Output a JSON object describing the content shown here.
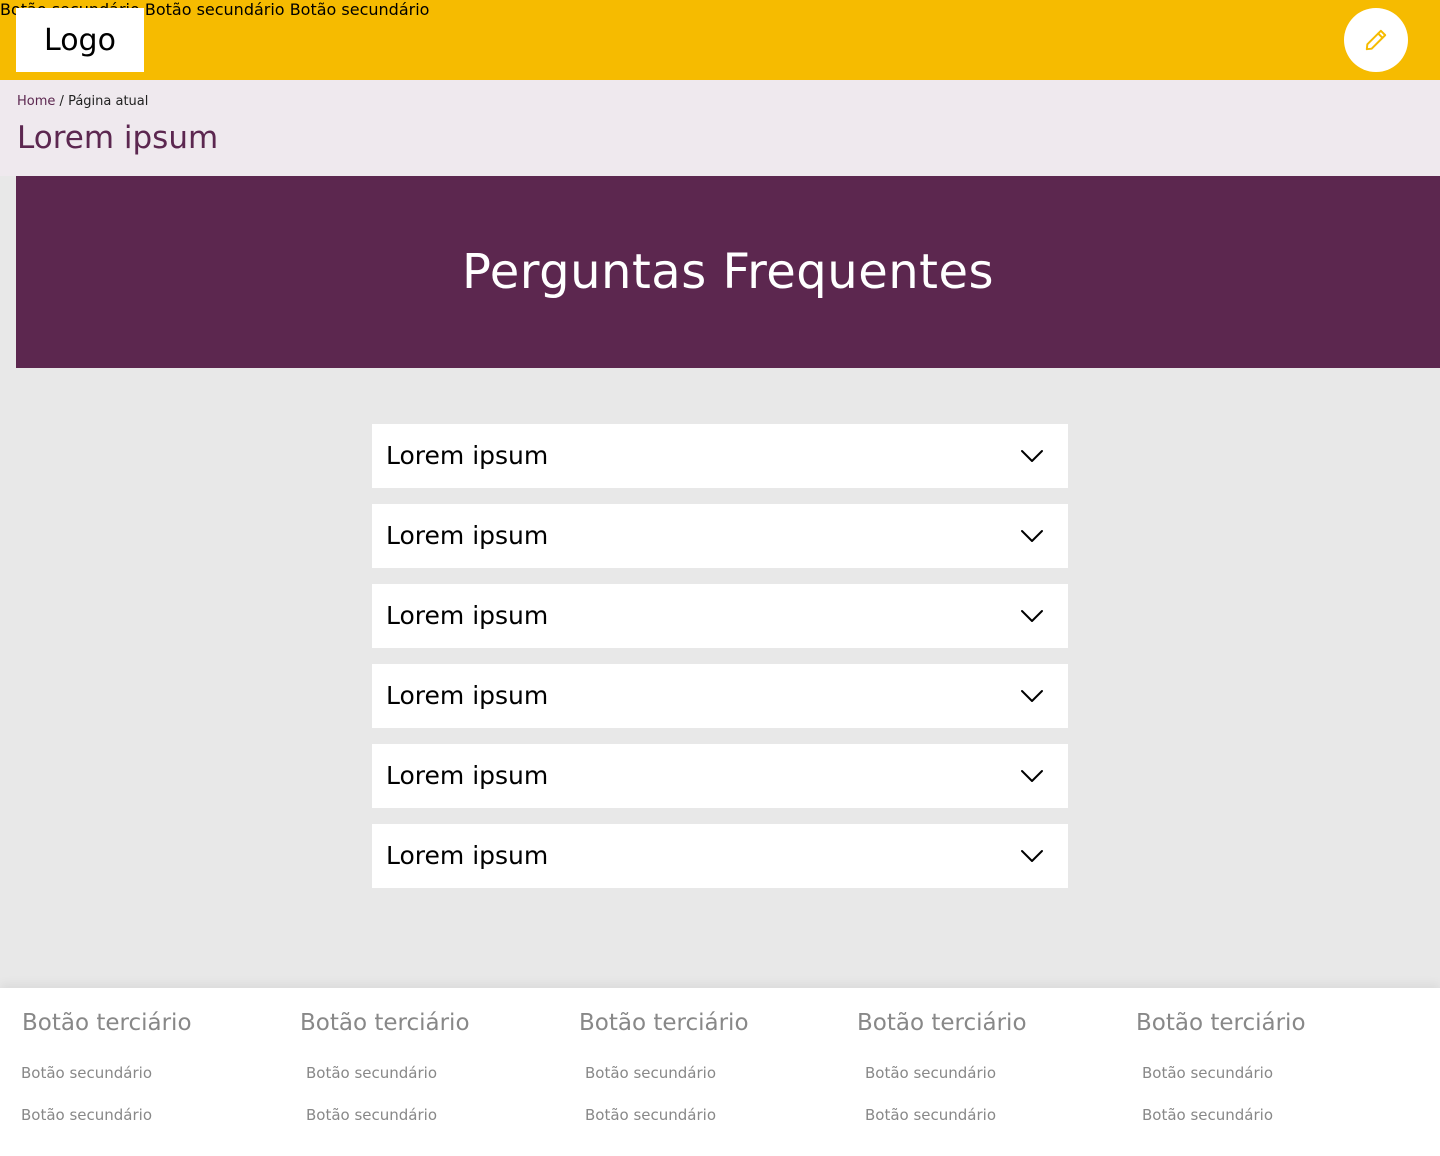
{
  "header": {
    "logo": "Logo",
    "nav": [
      "Botão secundário",
      "Botão secundário",
      "Botão secundário"
    ],
    "edit_icon": "pencil-icon",
    "colors": {
      "background": "#f6bb00",
      "edit_icon": "#f6bb00"
    }
  },
  "breadcrumb": {
    "home": "Home",
    "separator": "/",
    "current": "Página atual"
  },
  "page_title": "Lorem ipsum",
  "banner": {
    "title": "Perguntas Frequentes",
    "color": "#5c274f"
  },
  "faq": {
    "items": [
      "Lorem ipsum",
      "Lorem ipsum",
      "Lorem ipsum",
      "Lorem ipsum",
      "Lorem ipsum",
      "Lorem ipsum"
    ],
    "expand_icon": "chevron-down-icon"
  },
  "footer": {
    "columns": [
      {
        "title": "Botão terciário",
        "links": [
          "Botão secundário",
          "Botão secundário"
        ]
      },
      {
        "title": "Botão terciário",
        "links": [
          "Botão secundário",
          "Botão secundário"
        ]
      },
      {
        "title": "Botão terciário",
        "links": [
          "Botão secundário",
          "Botão secundário"
        ]
      },
      {
        "title": "Botão terciário",
        "links": [
          "Botão secundário",
          "Botão secundário"
        ]
      },
      {
        "title": "Botão terciário",
        "links": [
          "Botão secundário",
          "Botão secundário"
        ]
      }
    ]
  }
}
